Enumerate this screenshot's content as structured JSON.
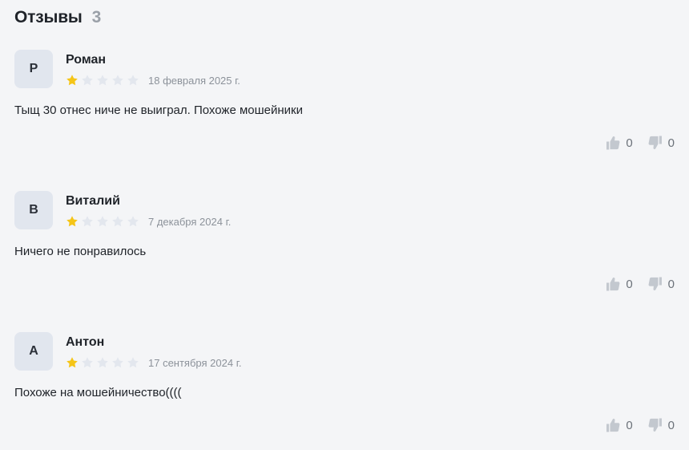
{
  "header": {
    "title": "Отзывы",
    "count": "3"
  },
  "colors": {
    "star_filled": "#f5c518",
    "star_empty": "#e3e7ee",
    "vote_icon": "#c3c8cf"
  },
  "icons": {
    "like": "thumbs-up-icon",
    "dislike": "thumbs-down-icon",
    "star": "star-icon"
  },
  "reviews": [
    {
      "initial": "Р",
      "name": "Роман",
      "rating": 1,
      "max_rating": 5,
      "date": "18 февраля 2025 г.",
      "text": "Тыщ 30 отнес ниче не выиграл. Похоже мошейники",
      "likes": "0",
      "dislikes": "0"
    },
    {
      "initial": "В",
      "name": "Виталий",
      "rating": 1,
      "max_rating": 5,
      "date": "7 декабря 2024 г.",
      "text": "Ничего не понравилось",
      "likes": "0",
      "dislikes": "0"
    },
    {
      "initial": "А",
      "name": "Антон",
      "rating": 1,
      "max_rating": 5,
      "date": "17 сентября 2024 г.",
      "text": "Похоже на мошейничество((((",
      "likes": "0",
      "dislikes": "0"
    }
  ]
}
